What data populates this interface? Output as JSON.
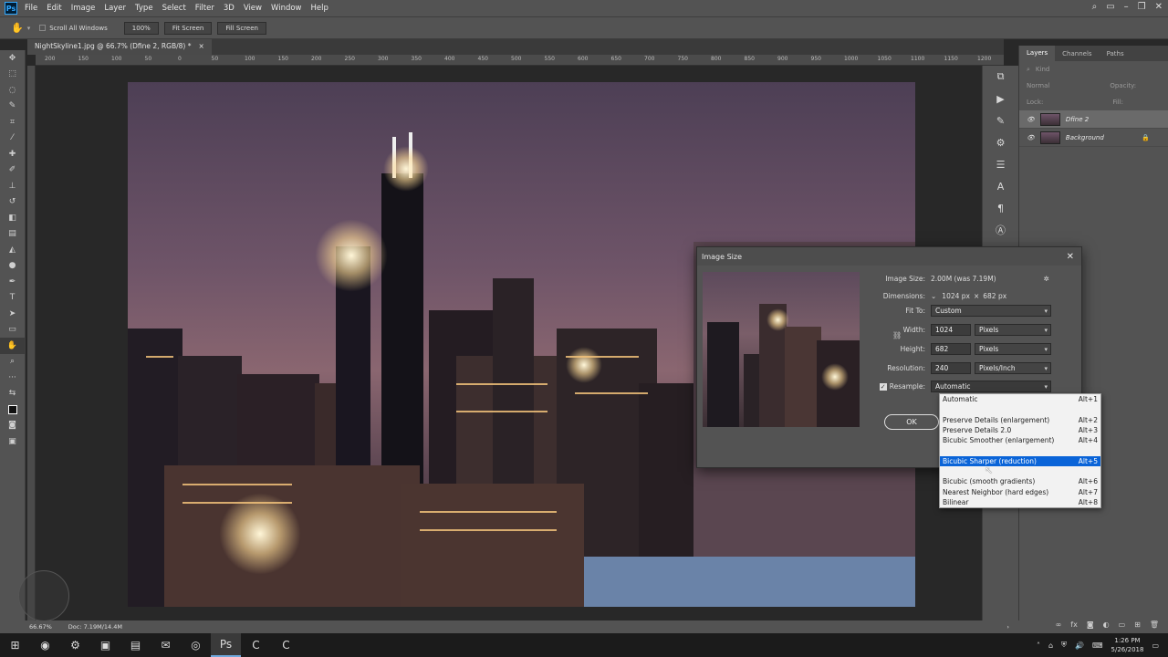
{
  "app": {
    "logo": "Ps"
  },
  "menu": [
    "File",
    "Edit",
    "Image",
    "Layer",
    "Type",
    "Select",
    "Filter",
    "3D",
    "View",
    "Window",
    "Help"
  ],
  "options": {
    "scroll_all": "Scroll All Windows",
    "zoom": "100%",
    "fit_screen": "Fit Screen",
    "fill_screen": "Fill Screen"
  },
  "document": {
    "tab_title": "NightSkyline1.jpg @ 66.7% (Dfine 2, RGB/8) *",
    "close": "×"
  },
  "ruler": [
    "200",
    "150",
    "100",
    "50",
    "0",
    "50",
    "100",
    "150",
    "200",
    "250",
    "300",
    "350",
    "400",
    "450",
    "500",
    "550",
    "600",
    "650",
    "700",
    "750",
    "800",
    "850",
    "900",
    "950",
    "1000",
    "1050",
    "1100",
    "1150",
    "1200"
  ],
  "status": {
    "zoom": "66.67%",
    "doc": "Doc: 7.19M/14.4M"
  },
  "panel": {
    "tabs": [
      "Layers",
      "Channels",
      "Paths"
    ],
    "kind": "Kind",
    "blend": "Normal",
    "opacity_label": "Opacity:",
    "lock_label": "Lock:",
    "fill_label": "Fill:",
    "layers": [
      {
        "name": "Dfine 2"
      },
      {
        "name": "Background"
      }
    ]
  },
  "dialog": {
    "title": "Image Size",
    "image_size_label": "Image Size:",
    "image_size_value": "2.00M (was 7.19M)",
    "dimensions_label": "Dimensions:",
    "dim_w": "1024 px",
    "dim_x": "×",
    "dim_h": "682 px",
    "fit_to_label": "Fit To:",
    "fit_to_value": "Custom",
    "width_label": "Width:",
    "width_value": "1024",
    "width_unit": "Pixels",
    "height_label": "Height:",
    "height_value": "682",
    "height_unit": "Pixels",
    "resolution_label": "Resolution:",
    "resolution_value": "240",
    "resolution_unit": "Pixels/Inch",
    "resample_label": "Resample:",
    "resample_value": "Automatic",
    "ok": "OK"
  },
  "resample_options": [
    {
      "label": "Automatic",
      "shortcut": "Alt+1"
    },
    {
      "label": "Preserve Details (enlargement)",
      "shortcut": "Alt+2"
    },
    {
      "label": "Preserve Details 2.0",
      "shortcut": "Alt+3"
    },
    {
      "label": "Bicubic Smoother (enlargement)",
      "shortcut": "Alt+4"
    },
    {
      "label": "Bicubic Sharper (reduction)",
      "shortcut": "Alt+5"
    },
    {
      "label": "Bicubic (smooth gradients)",
      "shortcut": "Alt+6"
    },
    {
      "label": "Nearest Neighbor (hard edges)",
      "shortcut": "Alt+7"
    },
    {
      "label": "Bilinear",
      "shortcut": "Alt+8"
    }
  ],
  "taskbar": {
    "time": "1:26 PM",
    "date": "5/26/2018"
  },
  "colors": {
    "accent": "#0a64d8",
    "chrome": "#535353",
    "canvas_bg": "#282828"
  }
}
